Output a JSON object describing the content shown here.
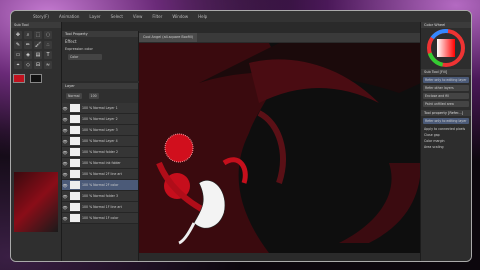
{
  "menu": [
    "Story(F)",
    "Animation",
    "Layer",
    "Select",
    "View",
    "Filter",
    "Window",
    "Help"
  ],
  "canvas_tab": "Cool Angel (all-square Boxfill)",
  "tool_sub_title": "Sub Tool",
  "tool_property": {
    "title": "Tool Property",
    "effect_label": "Effect",
    "expression_color_label": "Expression color",
    "expression_color_value": "Color"
  },
  "layer_panel": {
    "title": "Layer",
    "blend_label": "Normal",
    "opacity": "100",
    "layers": [
      {
        "name": "100 % Normal Layer 1",
        "selected": false
      },
      {
        "name": "100 % Normal Layer 2",
        "selected": false
      },
      {
        "name": "100 % Normal Layer 3",
        "selected": false
      },
      {
        "name": "100 % Normal Layer 4",
        "selected": false
      },
      {
        "name": "100 % Normal folder 2",
        "selected": false
      },
      {
        "name": "100 % Normal ink folder",
        "selected": false
      },
      {
        "name": "100 % Normal 2F line art",
        "selected": false
      },
      {
        "name": "100 % Normal 2F color",
        "selected": true
      },
      {
        "name": "100 % Normal folder 3",
        "selected": false
      },
      {
        "name": "100 % Normal 1F line art",
        "selected": false
      },
      {
        "name": "100 % Normal 1F color",
        "selected": false
      }
    ]
  },
  "right_panel": {
    "color_wheel_label": "Color Wheel",
    "subtool_title": "Sub Tool [Fill]",
    "items": [
      "Refer only to editing layer",
      "Refer other layers",
      "Enclose and fill",
      "Paint unfilled area"
    ],
    "prop_title": "Tool property [Refer...]",
    "prop_value": "Refer only to editing layer",
    "checks": [
      "Apply to connected pixels",
      "Close gap",
      "Color margin",
      "Area scaling"
    ]
  },
  "colors": {
    "accent": "#c0121e",
    "panel": "#2f2f2f",
    "frame": "#2a2a2a"
  }
}
